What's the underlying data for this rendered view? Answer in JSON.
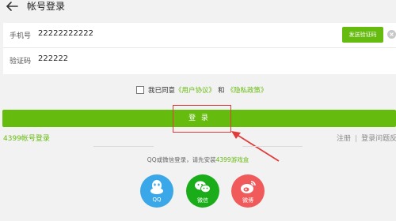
{
  "header": {
    "title": "帐号登录",
    "back_icon": "arrow-left-icon"
  },
  "form": {
    "phone": {
      "label": "手机号",
      "value": "22222222222"
    },
    "code": {
      "label": "验证码",
      "value": "222222"
    },
    "send_code_label": "发送验证码",
    "clear_icon": "close-circle-icon"
  },
  "agreement": {
    "prefix": "我已同意",
    "user_agreement": "《用户协议》",
    "and": "和",
    "privacy_policy": "《隐私政策》"
  },
  "login_button": {
    "label": "登 录"
  },
  "links": {
    "account_login": "4399帐号登录",
    "register": "注册",
    "separator": "|",
    "login_issue": "登录问题反馈"
  },
  "third_party": {
    "tip_prefix": "QQ或微信登录，请先安装",
    "tip_link": "4399游戏盒",
    "items": [
      {
        "label": "QQ",
        "icon": "qq-icon",
        "color": "#3aa8e8"
      },
      {
        "label": "微信",
        "icon": "wechat-icon",
        "color": "#1aad19"
      },
      {
        "label": "微博",
        "icon": "weibo-icon",
        "color": "#f05a5a"
      }
    ]
  },
  "colors": {
    "accent": "#66bb0f",
    "annotation": "#e23b3b",
    "background": "#f2f2f2"
  }
}
